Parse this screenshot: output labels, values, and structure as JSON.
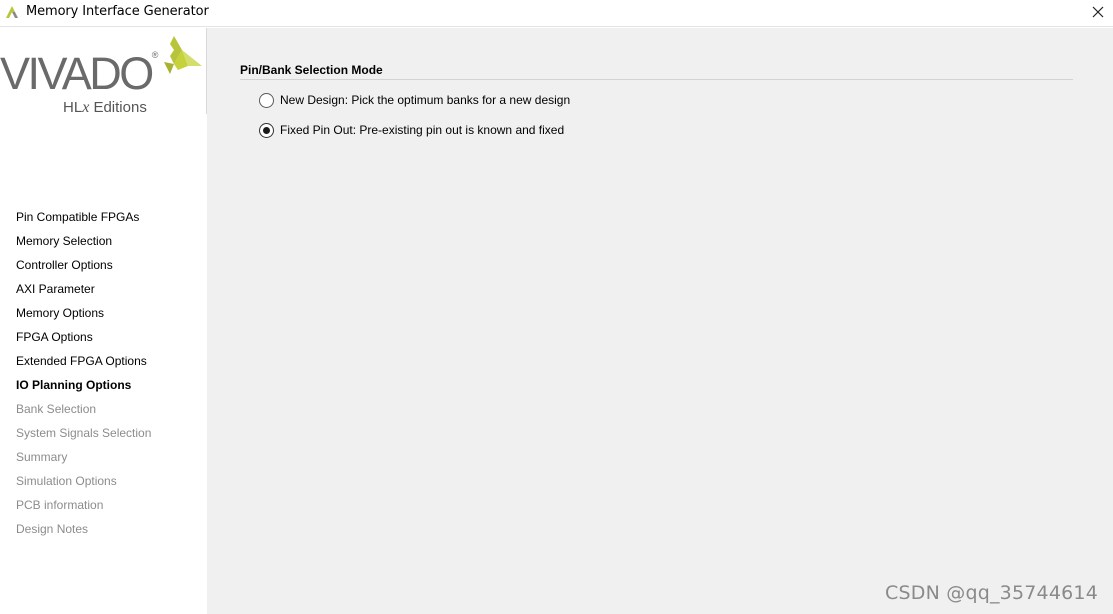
{
  "window": {
    "title": "Memory Interface Generator",
    "app_icon": "vivado-icon",
    "close_icon": "close-icon"
  },
  "logo": {
    "brand": "VIVADO",
    "registered": "®",
    "edition_prefix": "HL",
    "edition_x": "x",
    "edition_suffix": " Editions",
    "accent_color": "#c5d23a"
  },
  "sidebar": {
    "items": [
      {
        "label": "Pin Compatible FPGAs",
        "state": "normal"
      },
      {
        "label": "Memory Selection",
        "state": "normal"
      },
      {
        "label": "Controller Options",
        "state": "normal"
      },
      {
        "label": "AXI Parameter",
        "state": "normal"
      },
      {
        "label": "Memory Options",
        "state": "normal"
      },
      {
        "label": "FPGA Options",
        "state": "normal"
      },
      {
        "label": "Extended FPGA Options",
        "state": "normal"
      },
      {
        "label": "IO Planning Options",
        "state": "active"
      },
      {
        "label": "Bank Selection",
        "state": "disabled"
      },
      {
        "label": "System Signals Selection",
        "state": "disabled"
      },
      {
        "label": "Summary",
        "state": "disabled"
      },
      {
        "label": "Simulation Options",
        "state": "disabled"
      },
      {
        "label": "PCB information",
        "state": "disabled"
      },
      {
        "label": "Design Notes",
        "state": "disabled"
      }
    ]
  },
  "main": {
    "section_title": "Pin/Bank Selection Mode",
    "options": [
      {
        "label": "New Design: Pick the optimum banks for a new design",
        "checked": false
      },
      {
        "label": "Fixed Pin Out: Pre-existing pin out is known and fixed",
        "checked": true
      }
    ]
  },
  "watermark": "CSDN @qq_35744614"
}
